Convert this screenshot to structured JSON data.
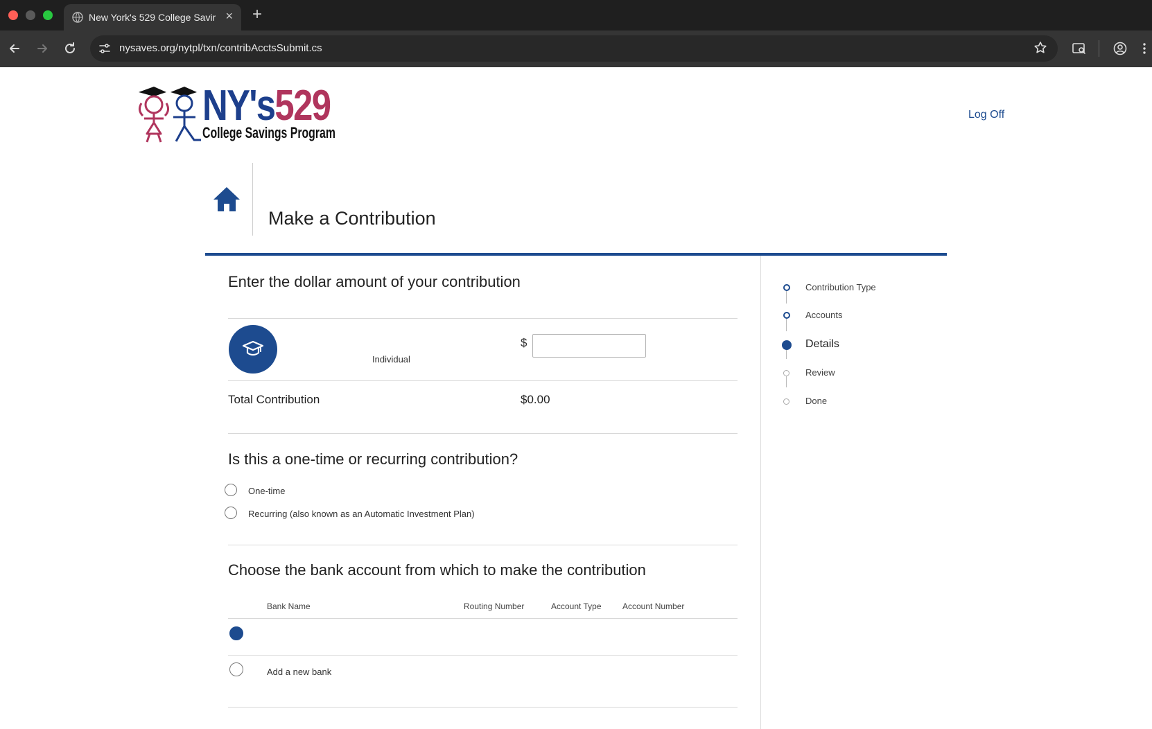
{
  "browser": {
    "tab_title": "New York's 529 College Savir",
    "url": "nysaves.org/nytpl/txn/contribAcctsSubmit.cs"
  },
  "header": {
    "logo_ny": "NY's",
    "logo_529": "529",
    "logo_sub": "College Savings Program",
    "logoff_label": "Log Off"
  },
  "page": {
    "title": "Make a Contribution"
  },
  "amount_section": {
    "heading": "Enter the dollar amount of your contribution",
    "fund_name": "Individual",
    "currency_symbol": "$",
    "amount_value": "",
    "total_label": "Total Contribution",
    "total_value": "$0.00"
  },
  "frequency_section": {
    "heading": "Is this a one-time or recurring contribution?",
    "options": [
      {
        "label": "One-time",
        "selected": false
      },
      {
        "label": "Recurring (also known as an Automatic Investment Plan)",
        "selected": false
      }
    ]
  },
  "bank_section": {
    "heading": "Choose the bank account from which to make the contribution",
    "columns": [
      "Bank Name",
      "Routing Number",
      "Account Type",
      "Account Number"
    ],
    "rows": [
      {
        "bank_name": "",
        "selected": true
      }
    ],
    "add_new_label": "Add a new bank"
  },
  "steps": [
    {
      "label": "Contribution Type",
      "state": "done"
    },
    {
      "label": "Accounts",
      "state": "done"
    },
    {
      "label": "Details",
      "state": "current"
    },
    {
      "label": "Review",
      "state": "future"
    },
    {
      "label": "Done",
      "state": "future"
    }
  ],
  "colors": {
    "brand_blue": "#1d4b8f",
    "brand_pink": "#b0355d"
  }
}
